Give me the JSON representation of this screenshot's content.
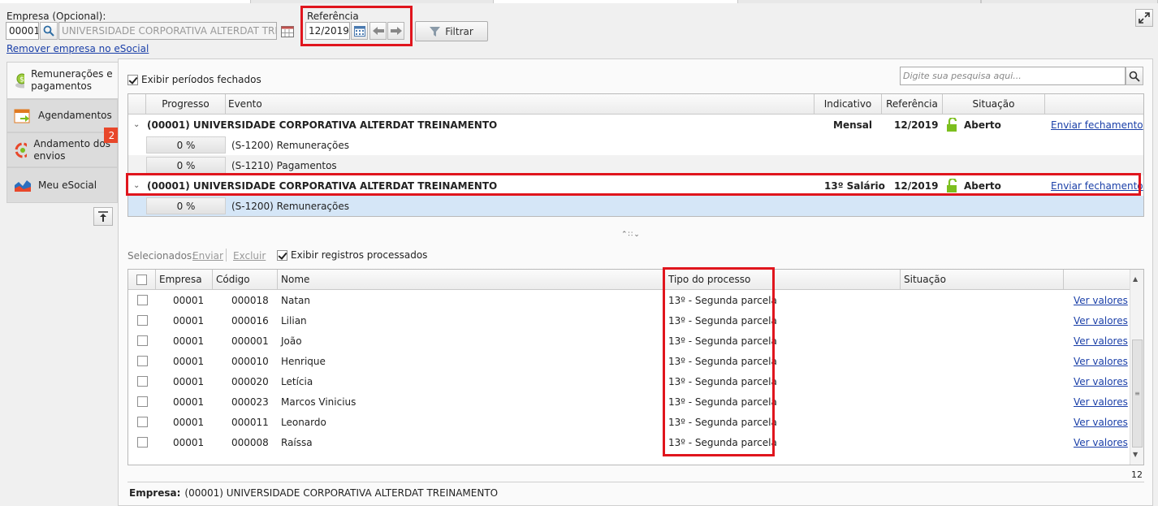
{
  "top": {
    "empresa_label": "Empresa (Opcional):",
    "empresa_code": "00001",
    "empresa_name": "UNIVERSIDADE CORPORATIVA ALTERDAT TREINAMENTO",
    "remove_link": "Remover empresa no eSocial",
    "referencia_label": "Referência",
    "referencia_value": "12/2019",
    "filter_label": "Filtrar"
  },
  "sidebar": {
    "items": [
      {
        "label": "Remunerações e pagamentos",
        "icon": "money-icon"
      },
      {
        "label": "Agendamentos",
        "icon": "calendar-icon"
      },
      {
        "label": "Andamento dos envios",
        "icon": "progress-icon",
        "badge": "2"
      },
      {
        "label": "Meu eSocial",
        "icon": "chart-icon"
      }
    ]
  },
  "periods": {
    "show_closed_label": "Exibir períodos fechados",
    "search_placeholder": "Digite sua pesquisa aqui...",
    "columns": [
      "Progresso",
      "Evento",
      "Indicativo",
      "Referência",
      "Situação"
    ],
    "groups": [
      {
        "title": "(00001) UNIVERSIDADE CORPORATIVA ALTERDAT TREINAMENTO",
        "indicativo": "Mensal",
        "referencia": "12/2019",
        "situacao": "Aberto",
        "action": "Enviar fechamento",
        "events": [
          {
            "progress": "0 %",
            "event": "(S-1200) Remunerações"
          },
          {
            "progress": "0 %",
            "event": "(S-1210) Pagamentos"
          }
        ]
      },
      {
        "title": "(00001) UNIVERSIDADE CORPORATIVA ALTERDAT TREINAMENTO",
        "indicativo": "13º Salário",
        "referencia": "12/2019",
        "situacao": "Aberto",
        "action": "Enviar fechamento",
        "events": [
          {
            "progress": "0 %",
            "event": "(S-1200) Remunerações"
          }
        ]
      }
    ]
  },
  "records": {
    "selected_label": "Selecionados:",
    "send_label": "Enviar",
    "delete_label": "Excluir",
    "show_processed_label": "Exibir registros processados",
    "columns": [
      "Empresa",
      "Código",
      "Nome",
      "Tipo do processo",
      "Situação"
    ],
    "link_label": "Ver valores",
    "rows": [
      {
        "empresa": "00001",
        "codigo": "000018",
        "nome": "Natan",
        "tipo": "13º - Segunda parcela",
        "situacao": ""
      },
      {
        "empresa": "00001",
        "codigo": "000016",
        "nome": "Lilian",
        "tipo": "13º - Segunda parcela",
        "situacao": ""
      },
      {
        "empresa": "00001",
        "codigo": "000001",
        "nome": "João",
        "tipo": "13º - Segunda parcela",
        "situacao": ""
      },
      {
        "empresa": "00001",
        "codigo": "000010",
        "nome": "Henrique",
        "tipo": "13º - Segunda parcela",
        "situacao": ""
      },
      {
        "empresa": "00001",
        "codigo": "000020",
        "nome": "Letícia",
        "tipo": "13º - Segunda parcela",
        "situacao": ""
      },
      {
        "empresa": "00001",
        "codigo": "000023",
        "nome": "Marcos Vinicius",
        "tipo": "13º - Segunda parcela",
        "situacao": ""
      },
      {
        "empresa": "00001",
        "codigo": "000011",
        "nome": "Leonardo",
        "tipo": "13º - Segunda parcela",
        "situacao": ""
      },
      {
        "empresa": "00001",
        "codigo": "000008",
        "nome": "Raíssa",
        "tipo": "13º - Segunda parcela",
        "situacao": ""
      }
    ],
    "count": "12"
  },
  "footer": {
    "label": "Empresa:",
    "value": "(00001) UNIVERSIDADE CORPORATIVA ALTERDAT TREINAMENTO"
  },
  "colors": {
    "highlight": "#e0151d",
    "link": "#1a3fa8",
    "badge": "#e8472a",
    "lock": "#7cbf1e"
  }
}
